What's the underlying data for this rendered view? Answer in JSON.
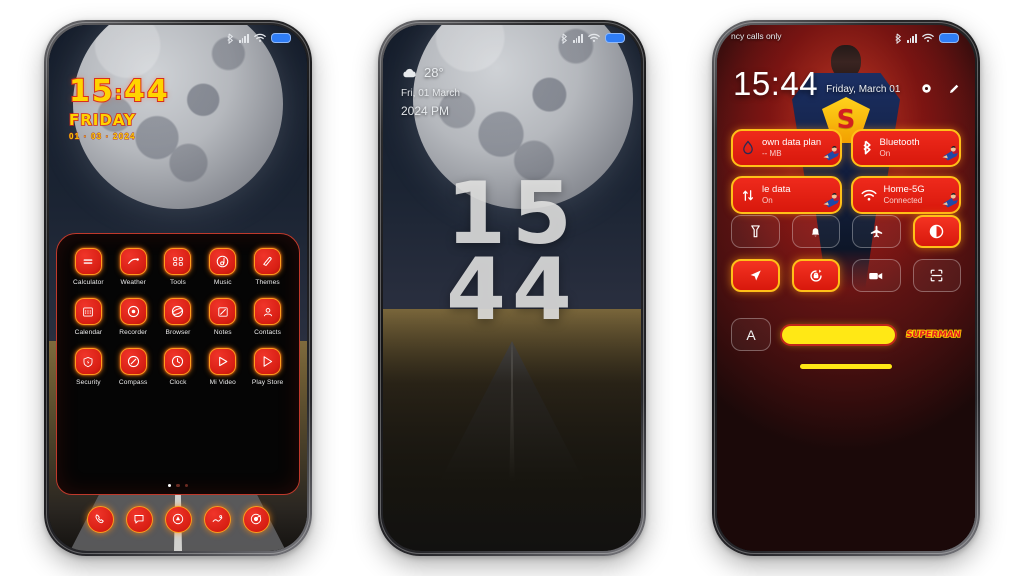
{
  "scene": {
    "background_color": "#ffffff",
    "phone_count": 3
  },
  "phone1": {
    "name": "home-screen-moon-theme",
    "statusbar": {
      "bluetooth": "bluetooth-icon",
      "signal": "signal-icon",
      "wifi": "wifi-icon",
      "battery": "battery-icon"
    },
    "clock": {
      "hours": "15",
      "colon": ":",
      "minutes": "44",
      "day": "FRIDAY",
      "date": "01 · 03 · 2024",
      "time_color": "#ffd400",
      "stroke_color": "#d1281c"
    },
    "apps": [
      {
        "label": "Calculator",
        "icon": "calculator-icon"
      },
      {
        "label": "Weather",
        "icon": "weather-icon"
      },
      {
        "label": "Tools",
        "icon": "tools-icon"
      },
      {
        "label": "Music",
        "icon": "music-icon"
      },
      {
        "label": "Themes",
        "icon": "themes-icon"
      },
      {
        "label": "Calendar",
        "icon": "calendar-icon"
      },
      {
        "label": "Recorder",
        "icon": "recorder-icon"
      },
      {
        "label": "Browser",
        "icon": "browser-icon"
      },
      {
        "label": "Notes",
        "icon": "notes-icon"
      },
      {
        "label": "Contacts",
        "icon": "contacts-icon"
      },
      {
        "label": "Security",
        "icon": "security-icon"
      },
      {
        "label": "Compass",
        "icon": "compass-icon"
      },
      {
        "label": "Clock",
        "icon": "clock-icon"
      },
      {
        "label": "Mi Video",
        "icon": "mi-video-icon"
      },
      {
        "label": "Play Store",
        "icon": "play-store-icon"
      }
    ],
    "page_dots": {
      "count": 3,
      "active_index": 0
    },
    "dock": [
      {
        "icon": "phone-icon"
      },
      {
        "icon": "messages-icon"
      },
      {
        "icon": "app-store-icon"
      },
      {
        "icon": "gallery-icon"
      },
      {
        "icon": "browser-round-icon"
      }
    ],
    "accent_color": "#d81f14",
    "glow_color": "#ff9b1c"
  },
  "phone2": {
    "name": "lock-screen-big-clock",
    "statusbar": {
      "bluetooth": "bluetooth-icon",
      "signal": "signal-icon",
      "wifi": "wifi-icon",
      "battery": "battery-icon"
    },
    "weather": {
      "icon": "cloud-icon",
      "temperature": "28°"
    },
    "date": "Fri, 01 March",
    "year_meridiem": "2024 PM",
    "big_clock": {
      "top": "15",
      "bottom": "44",
      "color": "#e4e4e2"
    }
  },
  "phone3": {
    "name": "control-center-superman-theme",
    "carrier_text": "ncy calls only",
    "statusbar": {
      "bluetooth": "bluetooth-icon",
      "signal": "signal-icon",
      "wifi": "wifi-icon",
      "battery": "battery-icon"
    },
    "clock": {
      "time": "15:44",
      "date": "Friday, March 01"
    },
    "header_actions": [
      {
        "icon": "settings-record-icon"
      },
      {
        "icon": "edit-pencil-icon"
      }
    ],
    "tiles": [
      {
        "title": "own data plan",
        "subtitle": "-- MB",
        "icon": "data-drop-icon",
        "active": true
      },
      {
        "title": "Bluetooth",
        "subtitle": "On",
        "icon": "bluetooth-icon",
        "active": true
      },
      {
        "title": "le data",
        "subtitle": "On",
        "icon": "mobile-data-icon",
        "active": true
      },
      {
        "title": "Home-5G",
        "subtitle": "Connected",
        "icon": "wifi-icon",
        "active": true
      }
    ],
    "quick_settings": [
      {
        "icon": "flashlight-icon",
        "active": false
      },
      {
        "icon": "bell-icon",
        "active": false
      },
      {
        "icon": "airplane-icon",
        "active": false
      },
      {
        "icon": "dark-mode-icon",
        "active": true
      },
      {
        "icon": "location-icon",
        "active": true
      },
      {
        "icon": "auto-rotate-icon",
        "active": true
      },
      {
        "icon": "screen-record-icon",
        "active": false
      },
      {
        "icon": "scan-qr-icon",
        "active": false
      }
    ],
    "brightness": {
      "auto_label": "A",
      "slider_value": 100,
      "slider_color": "#ffe815",
      "slider_border": "#c0281a"
    },
    "brand_logo": "SUPERMAN",
    "accent_color": "#d8180c",
    "glow_color": "#ffc018"
  }
}
